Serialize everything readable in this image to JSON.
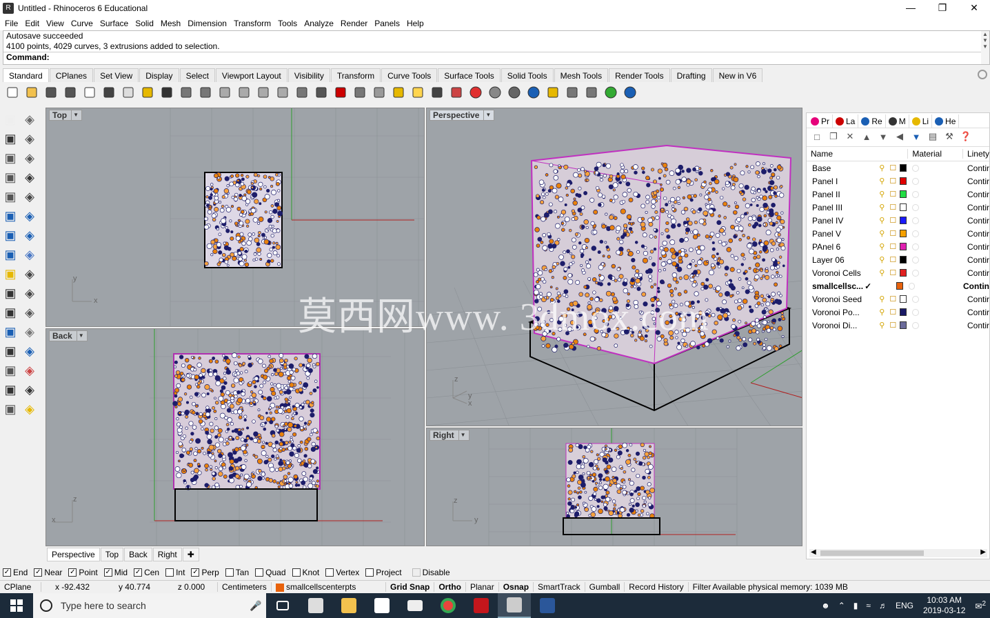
{
  "window": {
    "title": "Untitled - Rhinoceros 6 Educational",
    "controls": [
      "minimize",
      "restore",
      "close"
    ]
  },
  "menu": [
    "File",
    "Edit",
    "View",
    "Curve",
    "Surface",
    "Solid",
    "Mesh",
    "Dimension",
    "Transform",
    "Tools",
    "Analyze",
    "Render",
    "Panels",
    "Help"
  ],
  "command_history": {
    "line1": "Autosave succeeded",
    "line2": "4100 points, 4029 curves, 3 extrusions added to selection.",
    "prompt": "Command:"
  },
  "toolbar_tabs": [
    "Standard",
    "CPlanes",
    "Set View",
    "Display",
    "Select",
    "Viewport Layout",
    "Visibility",
    "Transform",
    "Curve Tools",
    "Surface Tools",
    "Solid Tools",
    "Mesh Tools",
    "Render Tools",
    "Drafting",
    "New in V6"
  ],
  "active_toolbar_tab": "Standard",
  "viewports": {
    "top": "Top",
    "back": "Back",
    "perspective": "Perspective",
    "right": "Right"
  },
  "axis_labels": {
    "x": "x",
    "y": "y",
    "z": "z"
  },
  "viewport_tabs": [
    "Perspective",
    "Top",
    "Back",
    "Right"
  ],
  "osnaps": [
    {
      "label": "End",
      "checked": true
    },
    {
      "label": "Near",
      "checked": true
    },
    {
      "label": "Point",
      "checked": true
    },
    {
      "label": "Mid",
      "checked": true
    },
    {
      "label": "Cen",
      "checked": true
    },
    {
      "label": "Int",
      "checked": false
    },
    {
      "label": "Perp",
      "checked": true
    },
    {
      "label": "Tan",
      "checked": false
    },
    {
      "label": "Quad",
      "checked": false
    },
    {
      "label": "Knot",
      "checked": false
    },
    {
      "label": "Vertex",
      "checked": false
    },
    {
      "label": "Project",
      "checked": false
    },
    {
      "label": "Disable",
      "checked": false
    }
  ],
  "status": {
    "cplane": "CPlane",
    "x": "x -92.432",
    "y": "y 40.774",
    "z": "z 0.000",
    "units": "Centimeters",
    "layer": "smallcellscenterpts",
    "grid_snap": "Grid Snap",
    "ortho": "Ortho",
    "planar": "Planar",
    "osnap": "Osnap",
    "smarttrack": "SmartTrack",
    "gumball": "Gumball",
    "record_history": "Record History",
    "filter": "Filter",
    "memory": "Available physical memory: 1039 MB"
  },
  "panel_tabs": [
    "Pr",
    "La",
    "Re",
    "M",
    "Li",
    "He"
  ],
  "layers_columns": {
    "name": "Name",
    "material": "Material",
    "linetype": "Linety"
  },
  "layers": [
    {
      "name": "Base",
      "color": "#000000",
      "linetype": "Contir",
      "current": false
    },
    {
      "name": "Panel I",
      "color": "#e00000",
      "linetype": "Contir",
      "current": false
    },
    {
      "name": "Panel II",
      "color": "#22dd44",
      "linetype": "Contir",
      "current": false
    },
    {
      "name": "Panel III",
      "color": "#ffffff",
      "linetype": "Contir",
      "current": false
    },
    {
      "name": "Panel IV",
      "color": "#1a1aff",
      "linetype": "Contir",
      "current": false
    },
    {
      "name": "Panel V",
      "color": "#f5a000",
      "linetype": "Contir",
      "current": false
    },
    {
      "name": "PAnel 6",
      "color": "#e020b0",
      "linetype": "Contir",
      "current": false
    },
    {
      "name": "Layer 06",
      "color": "#000000",
      "linetype": "Contir",
      "current": false
    },
    {
      "name": "Voronoi Cells",
      "color": "#e02020",
      "linetype": "Contir",
      "current": false
    },
    {
      "name": "smallcellsc...",
      "color": "#e8620c",
      "linetype": "Contin",
      "current": true
    },
    {
      "name": "Voronoi Seed",
      "color": "#ffffff",
      "linetype": "Contir",
      "current": false
    },
    {
      "name": "Voronoi Po...",
      "color": "#1a1a66",
      "linetype": "Contir",
      "current": false
    },
    {
      "name": "Voronoi Di...",
      "color": "#6a6a9a",
      "linetype": "Contir",
      "current": false
    }
  ],
  "taskbar": {
    "search_placeholder": "Type here to search",
    "language": "ENG",
    "time": "10:03 AM",
    "date": "2019-03-12",
    "notifications": "2"
  },
  "watermark": "莫西网www. 3dmox.com"
}
